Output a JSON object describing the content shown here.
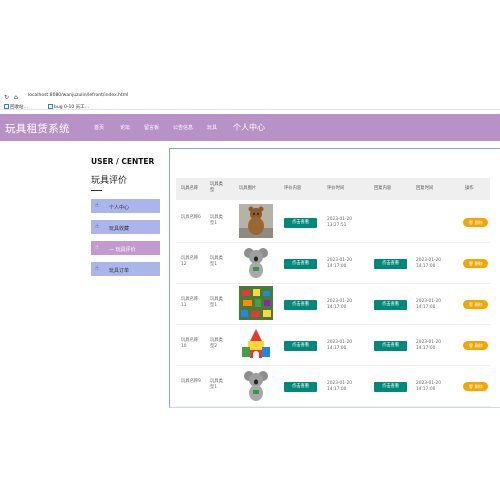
{
  "browser": {
    "url": "localhost:8080/wanjuzulin/lefront/index.html",
    "bookmarks": [
      "回收站…",
      "bug 0-10 员工…"
    ]
  },
  "header": {
    "title": "玩具租赁系统",
    "nav": [
      "首页",
      "论坛",
      "留言板",
      "公告信息",
      "玩具"
    ],
    "personal": "个人中心"
  },
  "sidebar": {
    "title": "USER / CENTER",
    "subtitle": "玩具评价",
    "items": [
      {
        "label": "个人中心"
      },
      {
        "label": "玩具收藏"
      },
      {
        "label": "— 玩具评价"
      },
      {
        "label": "玩具订单"
      }
    ]
  },
  "table": {
    "headers": [
      "玩具名称",
      "玩具类型",
      "玩具图片",
      "评价内容",
      "评价时间",
      "回复内容",
      "回复时间",
      "操作"
    ],
    "rows": [
      {
        "name": "玩具名称6",
        "type": "玩具类型1",
        "view": "点击查看",
        "eval_time": "2023-01-20 13:27:51",
        "reply": "",
        "reply_time": "",
        "op": "删除",
        "img": "bear"
      },
      {
        "name": "玩具名称12",
        "type": "玩具类型1",
        "view": "点击查看",
        "eval_time": "2023-01-20 14:17:00",
        "reply": "点击查看",
        "reply_time": "2023-01-20 14:17:00",
        "op": "删除",
        "img": "koala"
      },
      {
        "name": "玩具名称11",
        "type": "玩具类型1",
        "view": "点击查看",
        "eval_time": "2023-01-20 14:17:00",
        "reply": "点击查看",
        "reply_time": "2023-01-20 14:17:00",
        "op": "删除",
        "img": "blocks"
      },
      {
        "name": "玩具名称10",
        "type": "玩具类型2",
        "view": "点击查看",
        "eval_time": "2023-01-20 14:17:00",
        "reply": "点击查看",
        "reply_time": "2023-01-20 14:17:00",
        "op": "删除",
        "img": "castle"
      },
      {
        "name": "玩具名称9",
        "type": "玩具类型1",
        "view": "点击查看",
        "eval_time": "2023-01-20 14:17:00",
        "reply": "点击查看",
        "reply_time": "2023-01-20 14:17:00",
        "op": "删除",
        "img": "koala"
      }
    ]
  },
  "colors": {
    "header_bg": "#b892c7",
    "sidebar_item": "#aab5ec",
    "sidebar_active": "#c39acd",
    "view_button": "#00897b",
    "delete_button": "#f5a500"
  }
}
